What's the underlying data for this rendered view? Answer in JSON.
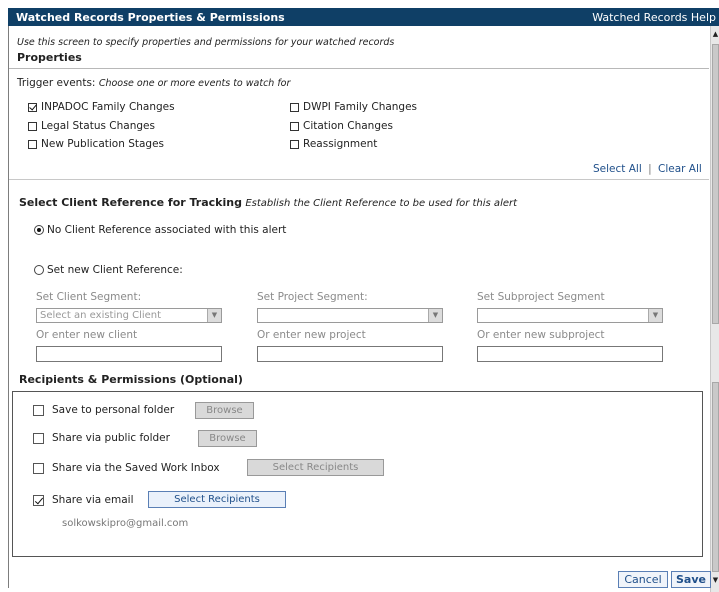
{
  "header": {
    "title": "Watched Records Properties & Permissions",
    "help_link": "Watched Records Help"
  },
  "intro": "Use this screen to specify properties and permissions for your watched records",
  "properties": {
    "heading": "Properties",
    "trigger_label": "Trigger events:",
    "trigger_hint": "Choose one or more events to watch for",
    "events": [
      {
        "label": "INPADOC Family Changes",
        "checked": true
      },
      {
        "label": "DWPI Family Changes",
        "checked": false
      },
      {
        "label": "Legal Status Changes",
        "checked": false
      },
      {
        "label": "Citation Changes",
        "checked": false
      },
      {
        "label": "New Publication Stages",
        "checked": false
      },
      {
        "label": "Reassignment",
        "checked": false
      }
    ],
    "select_all": "Select All",
    "clear_all": "Clear All"
  },
  "client_ref": {
    "heading": "Select Client Reference for Tracking",
    "hint": "Establish the Client Reference to be used for this alert",
    "option_none": "No Client Reference associated with this alert",
    "option_new": "Set new Client Reference:",
    "selected": "none",
    "client_segment_label": "Set Client Segment:",
    "project_segment_label": "Set Project Segment:",
    "subproject_segment_label": "Set Subproject Segment",
    "client_select_value": "Select an existing Client",
    "new_client_label": "Or enter new client",
    "new_project_label": "Or enter new project",
    "new_subproject_label": "Or enter new subproject"
  },
  "recipients": {
    "heading": "Recipients & Permissions (Optional)",
    "personal_folder": "Save to personal folder",
    "public_folder": "Share via public folder",
    "saved_work": "Share via the Saved Work Inbox",
    "email": "Share via email",
    "email_checked": true,
    "browse_label": "Browse",
    "select_recipients_label": "Select Recipients",
    "email_address": "solkowskipro@gmail.com"
  },
  "footer": {
    "cancel": "Cancel",
    "save": "Save"
  },
  "colors": {
    "header_bg": "#0f3f66",
    "link": "#1f4f8a"
  }
}
